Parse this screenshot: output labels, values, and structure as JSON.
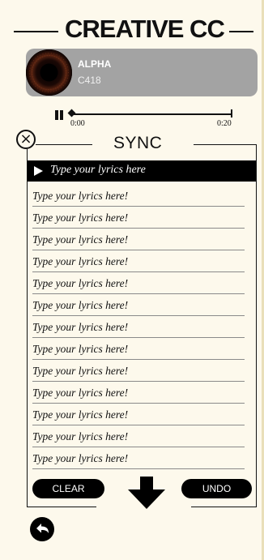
{
  "header": {
    "title": "CREATIVE CC"
  },
  "now_playing": {
    "title": "ALPHA",
    "artist": "C418"
  },
  "player": {
    "pause_icon": "pause-icon",
    "progress": 0.0,
    "time_start": "0:00",
    "time_end": "0:20"
  },
  "sync": {
    "title": "SYNC",
    "close_icon": "close-icon",
    "active_placeholder": "Type your lyrics here",
    "lines": [
      "Type your lyrics here!",
      "Type your lyrics here!",
      "Type your lyrics here!",
      "Type your lyrics here!",
      "Type your lyrics here!",
      "Type your lyrics here!",
      "Type your lyrics here!",
      "Type your lyrics here!",
      "Type your lyrics here!",
      "Type your lyrics here!",
      "Type your lyrics here!",
      "Type your lyrics here!",
      "Type your lyrics here!"
    ],
    "clear_label": "CLEAR",
    "undo_label": "UNDO",
    "down_icon": "down-arrow-icon"
  },
  "footer": {
    "back_icon": "undo-arrow-icon"
  },
  "colors": {
    "background": "#fdf9ec",
    "card": "#a3a3a3",
    "ink": "#000000"
  }
}
